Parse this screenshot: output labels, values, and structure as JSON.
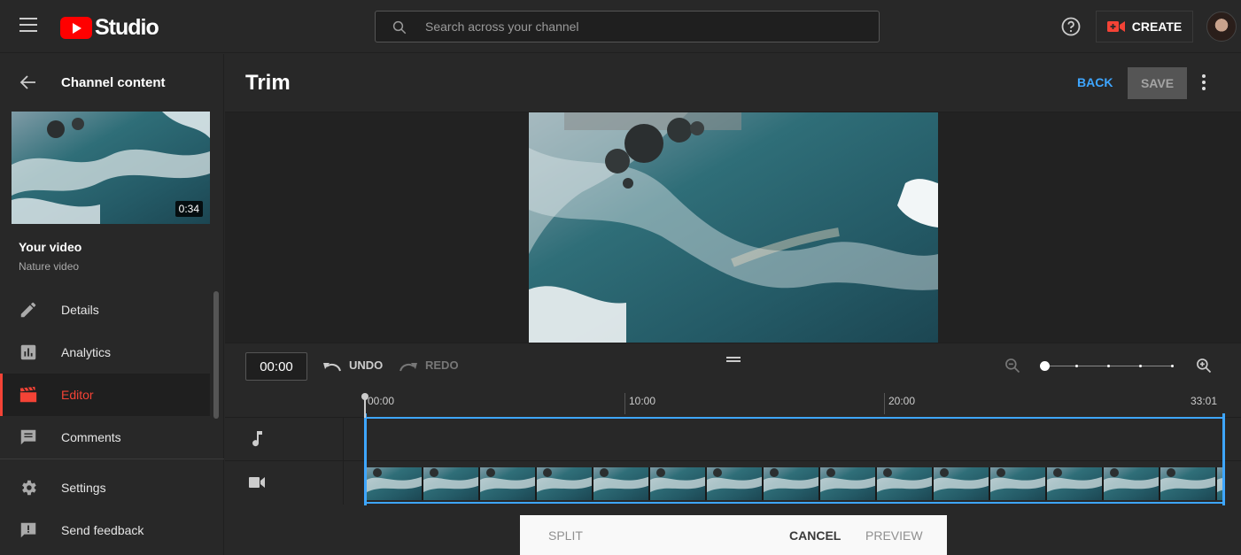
{
  "topbar": {
    "logo_text": "Studio",
    "search_placeholder": "Search across your channel",
    "create_label": "CREATE"
  },
  "sidebar": {
    "back_label": "Channel content",
    "thumbnail_duration": "0:34",
    "video_title": "Your video",
    "video_subtitle": "Nature video",
    "items": [
      {
        "label": "Details",
        "icon": "pencil-icon"
      },
      {
        "label": "Analytics",
        "icon": "analytics-icon"
      },
      {
        "label": "Editor",
        "icon": "clapperboard-icon"
      },
      {
        "label": "Comments",
        "icon": "comment-icon"
      },
      {
        "label": "Settings",
        "icon": "gear-icon"
      },
      {
        "label": "Send feedback",
        "icon": "feedback-icon"
      }
    ]
  },
  "header": {
    "title": "Trim",
    "back_label": "BACK",
    "save_label": "SAVE"
  },
  "timeline": {
    "current_time": "00:00",
    "undo_label": "UNDO",
    "redo_label": "REDO",
    "ruler": [
      "00:00",
      "10:00",
      "20:00",
      "33:01"
    ]
  },
  "bottom_bar": {
    "split_label": "SPLIT",
    "cancel_label": "CANCEL",
    "preview_label": "PREVIEW"
  },
  "colors": {
    "accent_blue": "#3ea6ff",
    "active_red": "#f44336",
    "background": "#282828"
  }
}
